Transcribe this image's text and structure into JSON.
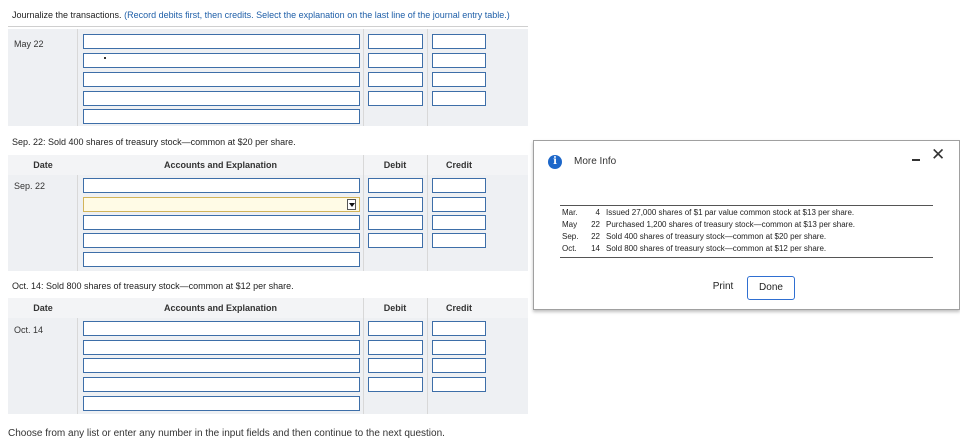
{
  "instructions": {
    "main": "Journalize the transactions.",
    "hint": "(Record debits first, then credits. Select the explanation on the last line of the journal entry table.)"
  },
  "entry1": {
    "date_label": "May 22"
  },
  "entry2": {
    "description": "Sep. 22: Sold 400 shares of treasury stock—common at $20 per share.",
    "headers": {
      "date": "Date",
      "accounts": "Accounts and Explanation",
      "debit": "Debit",
      "credit": "Credit"
    },
    "date_label": "Sep. 22"
  },
  "entry3": {
    "description": "Oct. 14: Sold 800 shares of treasury stock—common at $12 per share.",
    "headers": {
      "date": "Date",
      "accounts": "Accounts and Explanation",
      "debit": "Debit",
      "credit": "Credit"
    },
    "date_label": "Oct. 14"
  },
  "footer_text": "Choose from any list or enter any number in the input fields and then continue to the next question.",
  "modal": {
    "title": "More Info",
    "rows": [
      {
        "month": "Mar.",
        "day": "4",
        "text": "Issued 27,000 shares of $1 par value common stock at $13 per share."
      },
      {
        "month": "May",
        "day": "22",
        "text": "Purchased 1,200 shares of treasury stock—common at $13 per share."
      },
      {
        "month": "Sep.",
        "day": "22",
        "text": "Sold 400 shares of treasury stock—common at $20 per share."
      },
      {
        "month": "Oct.",
        "day": "14",
        "text": "Sold 800 shares of treasury stock—common at $12 per share."
      }
    ],
    "print_label": "Print",
    "done_label": "Done"
  },
  "colors": {
    "input_border": "#3d6ea8",
    "hint_text": "#1f5fa8",
    "done_border": "#2f6fd1",
    "info_icon": "#1d67c9"
  }
}
